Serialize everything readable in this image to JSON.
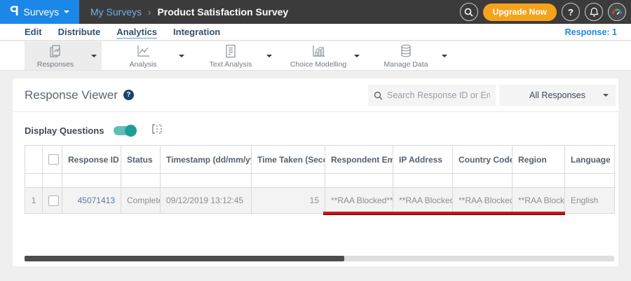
{
  "colors": {
    "brand_blue": "#1b87e6",
    "topbar_bg": "#3b3b3b",
    "upgrade_orange": "#f6a31c",
    "toggle_teal": "#1f9e94",
    "annotation_red": "#cf1717",
    "row_link_blue": "#557ca8"
  },
  "topbar": {
    "logo_glyph": "P",
    "product_menu": "Surveys",
    "breadcrumb": {
      "parent": "My Surveys",
      "separator": "›",
      "current": "Product Satisfaction Survey"
    },
    "upgrade_label": "Upgrade Now",
    "help_glyph": "?"
  },
  "nav": {
    "tabs": [
      {
        "label": "Edit"
      },
      {
        "label": "Distribute"
      },
      {
        "label": "Analytics"
      },
      {
        "label": "Integration"
      }
    ],
    "active_tab": "Analytics",
    "response_count": "Response: 1"
  },
  "toolbar": {
    "items": [
      {
        "label": "Responses",
        "icon": "responses-icon",
        "active": true
      },
      {
        "label": "Analysis",
        "icon": "analysis-icon",
        "active": false
      },
      {
        "label": "Text Analysis",
        "icon": "text-analysis-icon",
        "active": false
      },
      {
        "label": "Choice Modelling",
        "icon": "choice-modelling-icon",
        "active": false
      },
      {
        "label": "Manage Data",
        "icon": "manage-data-icon",
        "active": false
      }
    ]
  },
  "viewer": {
    "title": "Response Viewer",
    "help_glyph": "?",
    "search_placeholder": "Search Response ID or Email",
    "response_filter": "All Responses",
    "display_questions_label": "Display Questions",
    "display_questions_on": true
  },
  "table": {
    "columns": [
      {
        "label": "Response ID",
        "sort": "desc"
      },
      {
        "label": "Status",
        "sort": "none"
      },
      {
        "label": "Timestamp (dd/mm/yyyy)",
        "sort": "both"
      },
      {
        "label": "Time Taken (Seconds)",
        "sort": "both"
      },
      {
        "label": "Respondent Email",
        "sort": "none"
      },
      {
        "label": "IP Address",
        "sort": "none"
      },
      {
        "label": "Country Code",
        "sort": "none"
      },
      {
        "label": "Region",
        "sort": "none"
      },
      {
        "label": "Language",
        "sort": "none"
      }
    ],
    "rows": [
      {
        "index": "1",
        "response_id": "45071413",
        "status": "Completed",
        "timestamp": "09/12/2019 13:12:45",
        "time_taken": "15",
        "respondent_email": "**RAA Blocked**",
        "ip_address": "**RAA Blocked**",
        "country_code": "**RAA Blocked**",
        "region": "**RAA Blocked**",
        "language": "English"
      }
    ]
  }
}
